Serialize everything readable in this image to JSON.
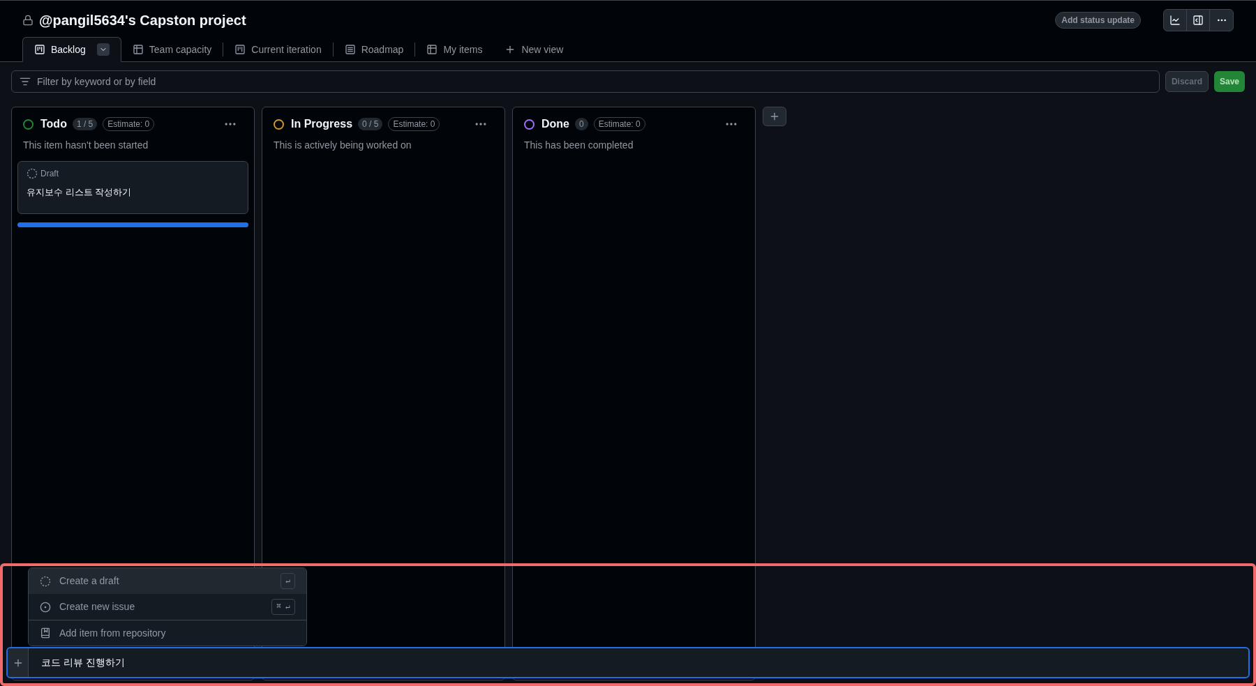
{
  "project": {
    "title": "@pangil5634's Capston project",
    "status_button": "Add status update"
  },
  "tabs": [
    {
      "label": "Backlog",
      "kind": "board",
      "selected": true,
      "menu": true
    },
    {
      "label": "Team capacity",
      "kind": "table",
      "selected": false,
      "menu": false
    },
    {
      "label": "Current iteration",
      "kind": "board",
      "selected": false,
      "menu": false
    },
    {
      "label": "Roadmap",
      "kind": "roadmap",
      "selected": false,
      "menu": false
    },
    {
      "label": "My items",
      "kind": "table",
      "selected": false,
      "menu": false
    }
  ],
  "new_view": "New view",
  "filter": {
    "placeholder": "Filter by keyword or by field"
  },
  "actions": [
    {
      "label": "Discard",
      "kind": "secondary",
      "disabled": true
    },
    {
      "label": "Save",
      "kind": "primary",
      "disabled": false
    }
  ],
  "columns": [
    {
      "name": "Todo",
      "color": "#238636",
      "count": "1 / 5",
      "estimate": "Estimate: 0",
      "description": "This item hasn't been started",
      "drop_target": true,
      "items": [
        {
          "status": "Draft",
          "title": "유지보수 리스트 작성하기"
        }
      ]
    },
    {
      "name": "In Progress",
      "color": "#d29922",
      "count": "0 / 5",
      "estimate": "Estimate: 0",
      "description": "This is actively being worked on",
      "drop_target": false
    },
    {
      "name": "Done",
      "color": "#a371f7",
      "count": "0",
      "estimate": "Estimate: 0",
      "description": "This has been completed",
      "drop_target": false
    }
  ],
  "add_menu": [
    {
      "label": "Create a draft",
      "kind": "draft",
      "shortcut": "↵",
      "selected": true
    },
    {
      "label": "Create new issue",
      "kind": "issue",
      "shortcut": "⌘ ↵",
      "selected": false
    },
    {
      "label": "Add item from repository",
      "kind": "repo",
      "selected": false
    }
  ],
  "new_item": {
    "value": "코드 리뷰 진행하기"
  }
}
